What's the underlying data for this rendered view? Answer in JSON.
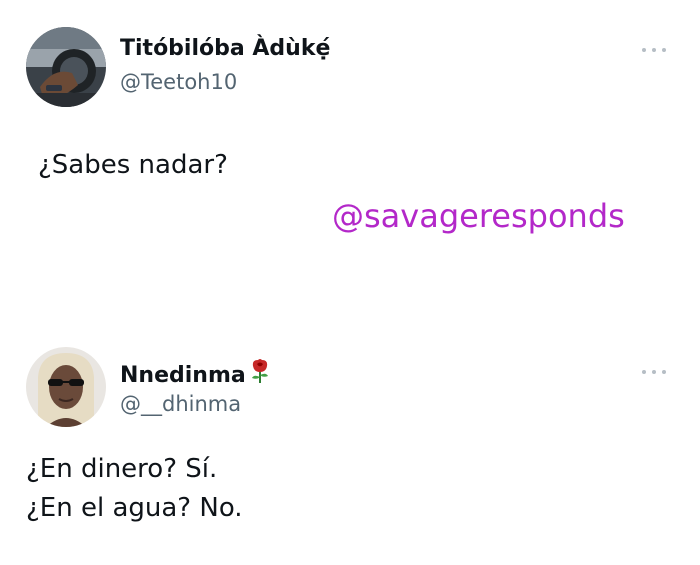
{
  "tweets": [
    {
      "display_name": "Titóbilóba Àdùkẹ́",
      "handle": "@Teetoh10",
      "text": "¿Sabes nadar?"
    },
    {
      "display_name": "Nnedinma",
      "name_emoji": "rose-icon",
      "handle": "@__dhinma",
      "text_lines": [
        "¿En dinero? Sí.",
        "¿En el agua? No."
      ]
    }
  ],
  "watermark": "@savageresponds",
  "colors": {
    "text": "#0f1419",
    "handle": "#536471",
    "watermark": "#b328c9",
    "more_dots": "#b6bec5"
  }
}
